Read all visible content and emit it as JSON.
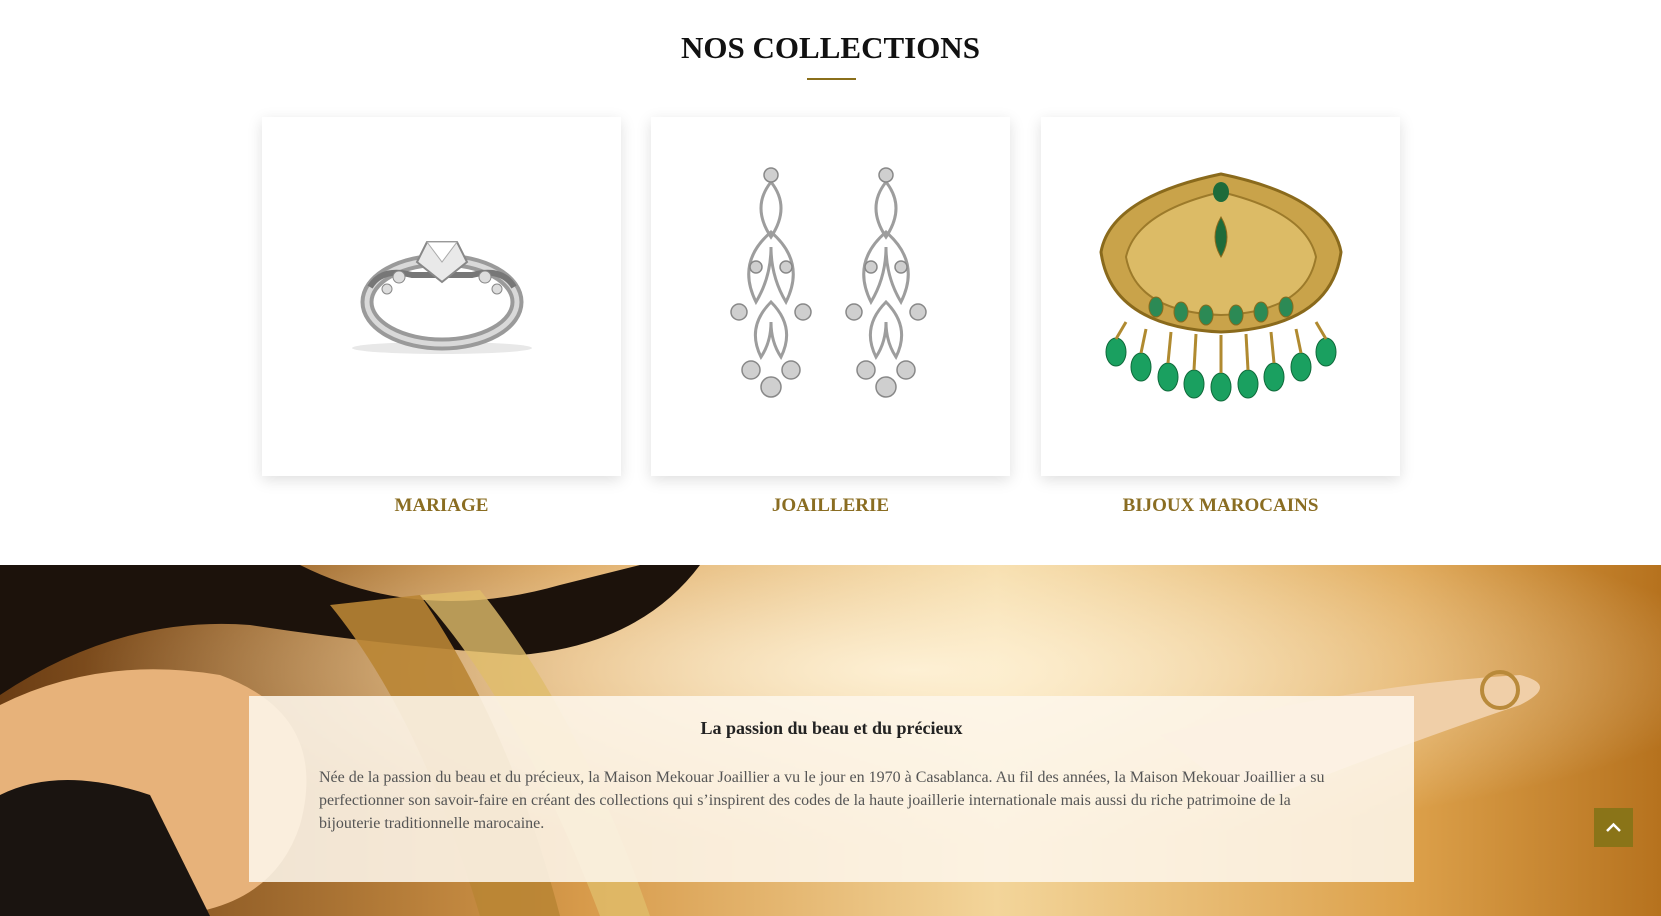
{
  "collections": {
    "title": "NOS COLLECTIONS",
    "items": [
      {
        "label": "MARIAGE",
        "image": "diamond-ring-image"
      },
      {
        "label": "JOAILLERIE",
        "image": "diamond-chandelier-earrings-image"
      },
      {
        "label": "BIJOUX MAROCAINS",
        "image": "gold-emerald-moroccan-pendant-image"
      }
    ]
  },
  "about": {
    "heading": "La passion du beau et du précieux",
    "text": "Née de la passion du beau et du précieux, la Maison Mekouar Joaillier a vu le jour en 1970 à Casablanca. Au fil des années, la Maison Mekouar Joaillier a su perfectionner son savoir-faire en créant des collections qui s’inspirent des codes de la haute joaillerie internationale mais aussi du riche patrimoine de la bijouterie traditionnelle marocaine."
  },
  "scroll_top": {
    "icon": "chevron-up-icon"
  },
  "colors": {
    "accent_gold": "#8a6d22",
    "button_gold": "#8a7418",
    "title_line": "#8a6f1b"
  }
}
